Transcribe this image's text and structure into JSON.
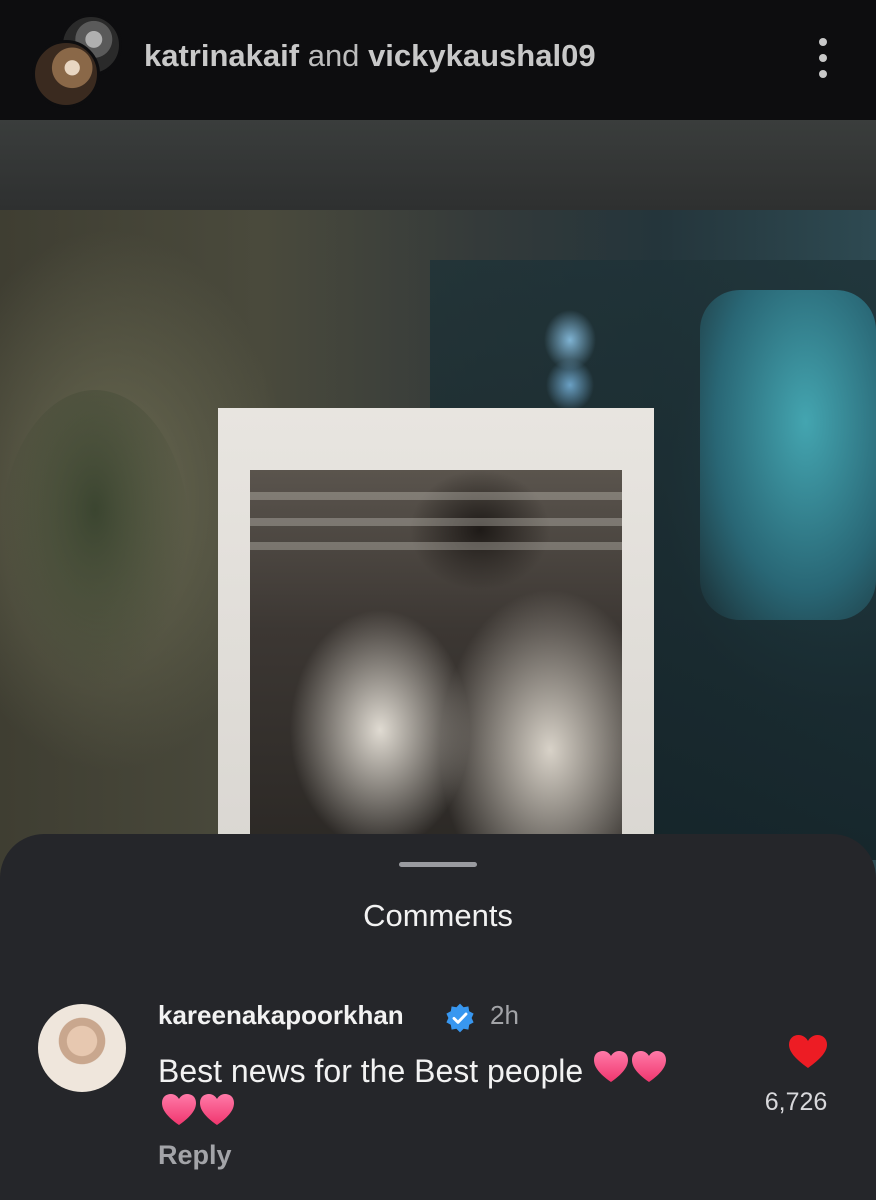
{
  "header": {
    "user1": "katrinakaif",
    "joiner": "and",
    "user2": "vickykaushal09"
  },
  "sheet": {
    "title": "Comments"
  },
  "comment": {
    "username": "kareenakapoorkhan",
    "verified": true,
    "time": "2h",
    "text": "Best news for the Best people",
    "reply_label": "Reply",
    "like_count": "6,726",
    "like_color": "#ed1c24",
    "emoji": "heart"
  },
  "colors": {
    "sheet_bg": "#25262a",
    "header_bg": "#0d0d0f",
    "verified_badge": "#3897f0"
  }
}
